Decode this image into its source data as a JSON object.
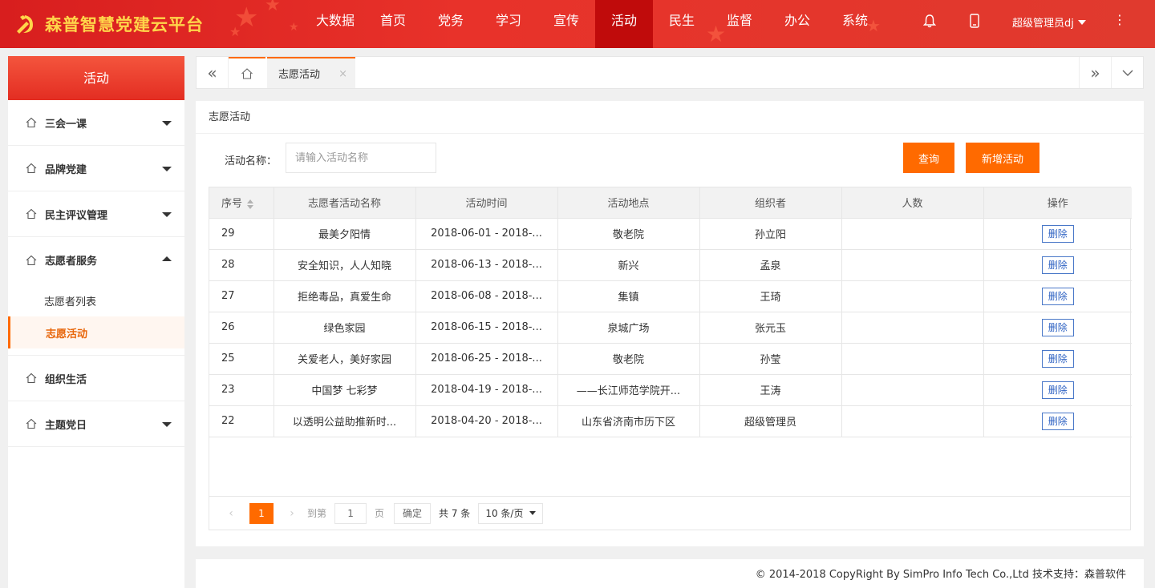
{
  "header": {
    "logo_text": "森普智慧党建云平台",
    "nav": [
      {
        "label": "大数据",
        "active": false
      },
      {
        "label": "首页",
        "active": false
      },
      {
        "label": "党务",
        "active": false
      },
      {
        "label": "学习",
        "active": false
      },
      {
        "label": "宣传",
        "active": false
      },
      {
        "label": "活动",
        "active": true
      },
      {
        "label": "民生",
        "active": false
      },
      {
        "label": "监督",
        "active": false
      },
      {
        "label": "办公",
        "active": false
      },
      {
        "label": "系统",
        "active": false
      }
    ],
    "user": "超级管理员dj",
    "more_icon": "⋮"
  },
  "sidebar": {
    "title": "活动",
    "items": [
      {
        "label": "三会一课",
        "expanded": false
      },
      {
        "label": "品牌党建",
        "expanded": false
      },
      {
        "label": "民主评议管理",
        "expanded": false
      },
      {
        "label": "志愿者服务",
        "expanded": true,
        "children": [
          {
            "label": "志愿者列表",
            "active": false
          },
          {
            "label": "志愿活动",
            "active": true
          }
        ]
      },
      {
        "label": "组织生活",
        "expanded": false
      },
      {
        "label": "主题党日",
        "expanded": false
      }
    ]
  },
  "tabs": {
    "left_nav_icon": "«",
    "right_nav_icon": "»",
    "active_tab": "志愿活动",
    "close_icon": "×"
  },
  "panel": {
    "title": "志愿活动",
    "search": {
      "label": "活动名称：",
      "placeholder": "请输入活动名称",
      "value": ""
    },
    "query_button": "查询",
    "add_button": "新增活动"
  },
  "table": {
    "columns": [
      "序号",
      "志愿者活动名称",
      "活动时间",
      "活动地点",
      "组织者",
      "人数",
      "操作"
    ],
    "rows": [
      {
        "id": "29",
        "name": "最美夕阳情",
        "time": "2018-06-01 - 2018-...",
        "place": "敬老院",
        "organizer": "孙立阳",
        "count": "",
        "action": "删除"
      },
      {
        "id": "28",
        "name": "安全知识，人人知晓",
        "time": "2018-06-13 - 2018-...",
        "place": "新兴",
        "organizer": "孟泉",
        "count": "",
        "action": "删除"
      },
      {
        "id": "27",
        "name": "拒绝毒品，真爱生命",
        "time": "2018-06-08 - 2018-...",
        "place": "集镇",
        "organizer": "王琦",
        "count": "",
        "action": "删除"
      },
      {
        "id": "26",
        "name": "绿色家园",
        "time": "2018-06-15 - 2018-...",
        "place": "泉城广场",
        "organizer": "张元玉",
        "count": "",
        "action": "删除"
      },
      {
        "id": "25",
        "name": "关爱老人，美好家园",
        "time": "2018-06-25 - 2018-...",
        "place": "敬老院",
        "organizer": "孙莹",
        "count": "",
        "action": "删除"
      },
      {
        "id": "23",
        "name": "中国梦 七彩梦",
        "time": "2018-04-19 - 2018-...",
        "place": "——长江师范学院开...",
        "organizer": "王涛",
        "count": "",
        "action": "删除"
      },
      {
        "id": "22",
        "name": "以透明公益助推新时...",
        "time": "2018-04-20 - 2018-...",
        "place": "山东省济南市历下区",
        "organizer": "超级管理员",
        "count": "",
        "action": "删除"
      }
    ]
  },
  "pager": {
    "prev": "‹",
    "current": "1",
    "next": "›",
    "goto_label": "到第",
    "goto_value": "1",
    "page_label": "页",
    "confirm": "确定",
    "total": "共 7 条",
    "page_size": "10 条/页"
  },
  "footer": {
    "text": "© 2014-2018 CopyRight By SimPro Info Tech Co.,Ltd 技术支持：森普软件"
  },
  "colors": {
    "header_red": "#e32d22",
    "active_nav": "#c00b0b",
    "accent_orange": "#ff6a00",
    "delete_blue": "#2f63c3"
  }
}
